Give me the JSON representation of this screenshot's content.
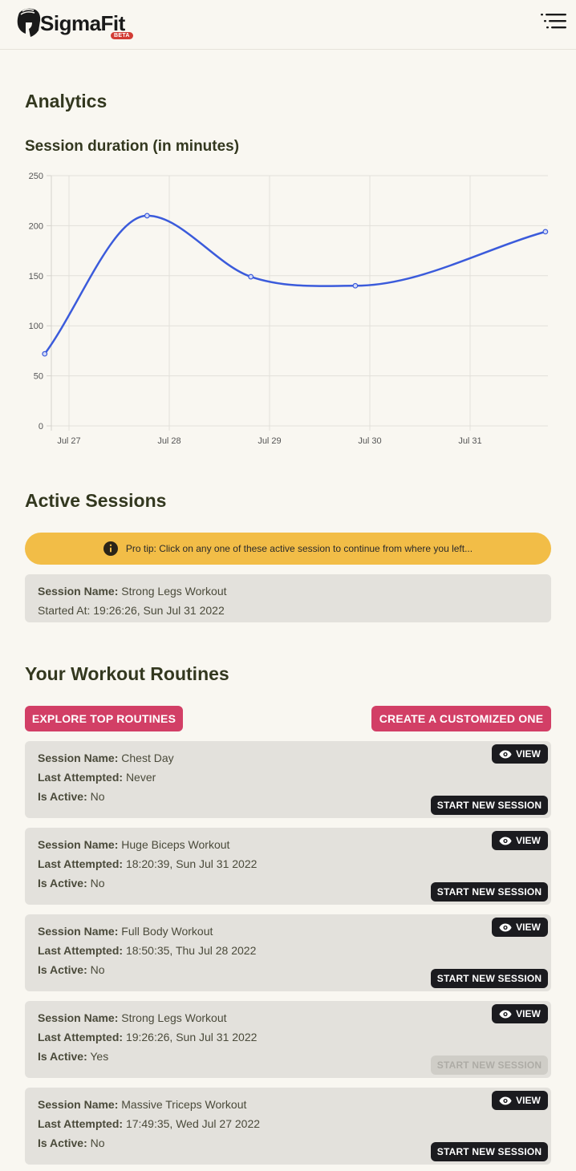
{
  "header": {
    "brand": "SigmaFit",
    "badge": "BETA"
  },
  "analytics": {
    "heading": "Analytics"
  },
  "chart_data": {
    "type": "line",
    "title": "Session duration (in minutes)",
    "xlabel": "",
    "ylabel": "",
    "ylim": [
      0,
      250
    ],
    "yticks": [
      0,
      50,
      100,
      150,
      200,
      250
    ],
    "xticks": [
      "Jul 27",
      "Jul 28",
      "Jul 29",
      "Jul 30",
      "Jul 31"
    ],
    "grid": true,
    "color": "#3b5bdb",
    "series": [
      {
        "x": [
          "2022-07-26 19:40",
          "2022-07-27 20:10",
          "2022-07-28 21:00",
          "2022-07-29 22:00",
          "2022-07-31 19:30"
        ],
        "values": [
          72,
          210,
          149,
          140,
          194
        ]
      }
    ]
  },
  "active_sessions": {
    "heading": "Active Sessions",
    "tip": "Pro tip: Click on any one of these active session to continue from where you left...",
    "items": [
      {
        "name_label": "Session Name:",
        "name": "Strong Legs Workout",
        "started": "Started At: 19:26:26, Sun Jul 31 2022"
      }
    ]
  },
  "routines": {
    "heading": "Your Workout Routines",
    "explore_label": "EXPLORE TOP ROUTINES",
    "create_label": "CREATE A CUSTOMIZED ONE",
    "view_label": "VIEW",
    "start_label": "START NEW SESSION",
    "name_label": "Session Name:",
    "attempted_label": "Last Attempted:",
    "active_label": "Is Active:",
    "items": [
      {
        "name": "Chest Day",
        "last_attempted": "Never",
        "is_active": "No"
      },
      {
        "name": "Huge Biceps Workout",
        "last_attempted": "18:20:39, Sun Jul 31 2022",
        "is_active": "No"
      },
      {
        "name": "Full Body Workout",
        "last_attempted": "18:50:35, Thu Jul 28 2022",
        "is_active": "No"
      },
      {
        "name": "Strong Legs Workout",
        "last_attempted": "19:26:26, Sun Jul 31 2022",
        "is_active": "Yes"
      },
      {
        "name": "Massive Triceps Workout",
        "last_attempted": "17:49:35, Wed Jul 27 2022",
        "is_active": "No"
      }
    ]
  }
}
